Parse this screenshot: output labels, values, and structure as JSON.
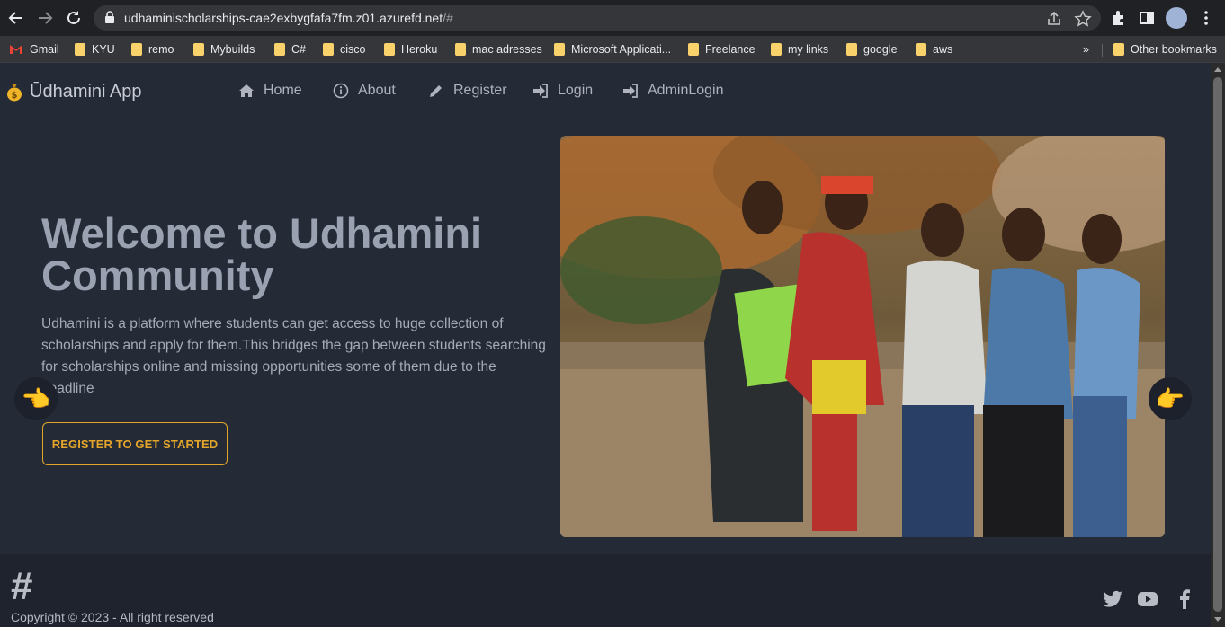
{
  "browser": {
    "url_host": "udhaminischolarships-cae2exbygfafa7fm.z01.azurefd.net",
    "url_path": "/#",
    "bookmarks": [
      "Gmail",
      "KYU",
      "remo",
      "Mybuilds",
      "C#",
      "cisco",
      "Heroku",
      "mac adresses",
      "Microsoft Applicati...",
      "Freelance",
      "my links",
      "google",
      "aws"
    ],
    "overflow": "»",
    "other_bookmarks": "Other bookmarks"
  },
  "nav": {
    "brand": "Ūdhamini App",
    "items": [
      {
        "label": "Home",
        "icon": "home-icon"
      },
      {
        "label": "About",
        "icon": "info-icon"
      },
      {
        "label": "Register",
        "icon": "pencil-icon"
      },
      {
        "label": "Login",
        "icon": "sign-in-icon"
      },
      {
        "label": "AdminLogin",
        "icon": "sign-in-icon"
      }
    ]
  },
  "hero": {
    "title": "Welcome to Udhamini Community",
    "description": "Udhamini is a platform where students can get access to huge collection of scholarships and apply for them.This bridges the gap between students searching for scholarships online and missing opportunities some of them due to the deadline",
    "cta_label": "REGISTER TO GET STARTED",
    "prev_glyph": "👈",
    "next_glyph": "👉"
  },
  "footer": {
    "logo_glyph": "#",
    "copyright": "Copyright © 2023 - All right reserved",
    "social": [
      "twitter-icon",
      "youtube-icon",
      "facebook-icon"
    ]
  },
  "colors": {
    "accent": "#e3a62a",
    "page_bg": "#252a37",
    "footer_bg": "#1f232d"
  }
}
